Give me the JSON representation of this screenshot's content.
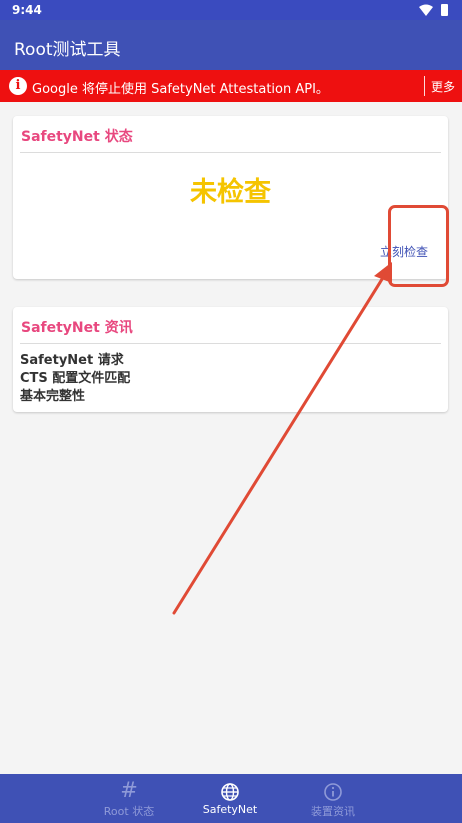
{
  "status_bar": {
    "time": "9:44",
    "icons": [
      "wifi-icon",
      "battery-icon"
    ]
  },
  "app_bar": {
    "title": "Root测试工具"
  },
  "banner": {
    "text": "Google 将停止使用 SafetyNet Attestation API。",
    "more_label": "更多",
    "icon": "info-icon"
  },
  "status_card": {
    "title": "SafetyNet 状态",
    "status": "未检查",
    "check_button": "立刻检查"
  },
  "info_card": {
    "title": "SafetyNet 资讯",
    "lines": [
      "SafetyNet 请求",
      "CTS 配置文件匹配",
      "基本完整性"
    ]
  },
  "bottom_nav": [
    {
      "label": "Root 状态",
      "icon": "hash-icon",
      "active": false
    },
    {
      "label": "SafetyNet",
      "icon": "globe-icon",
      "active": true
    },
    {
      "label": "装置资讯",
      "icon": "info-circle-icon",
      "active": false
    }
  ],
  "colors": {
    "app_bar": "#3f51b5",
    "banner": "#ee1010",
    "card_title": "#e8487f",
    "status_value": "#f5c400",
    "annotation": "#e04a35"
  }
}
